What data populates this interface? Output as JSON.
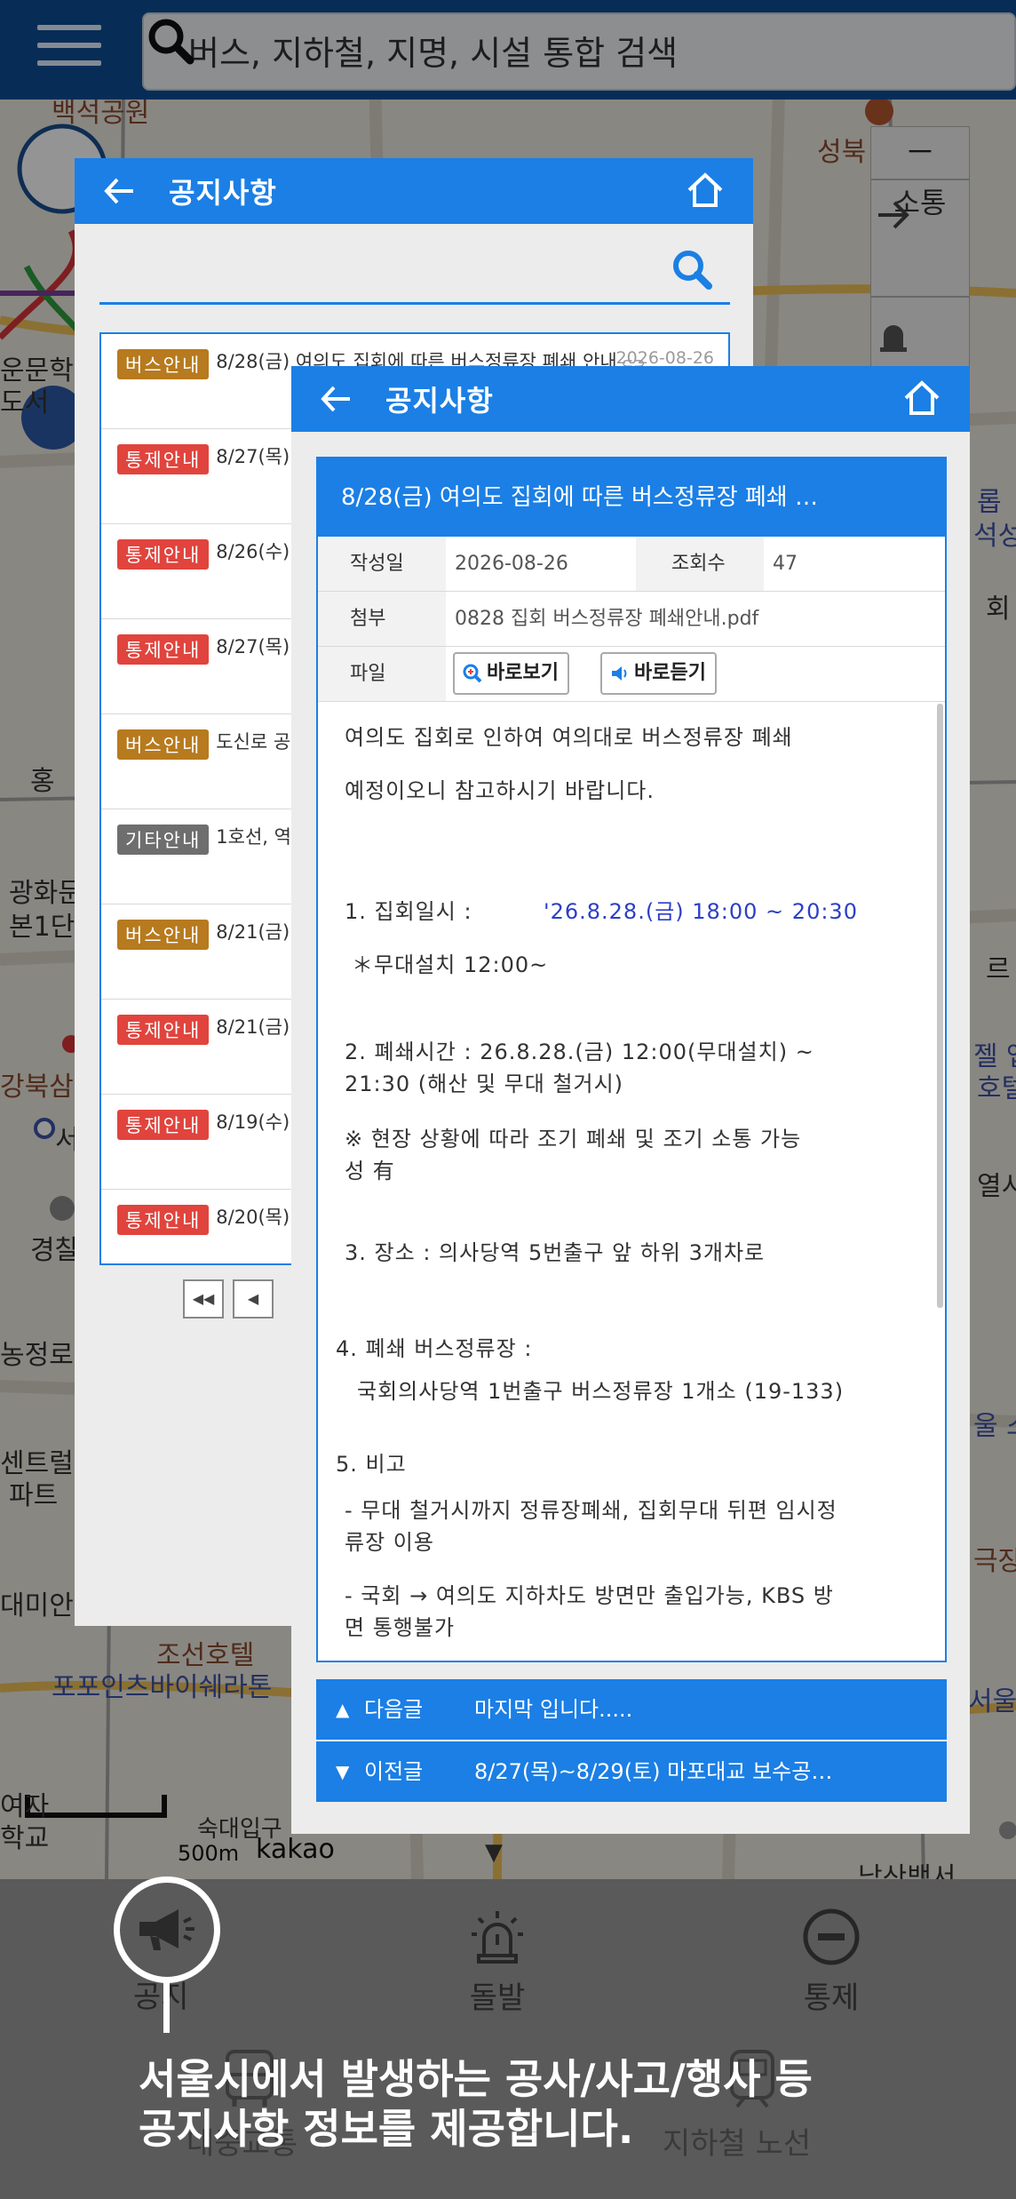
{
  "topbar": {
    "search_placeholder": "버스, 지하철, 지명, 시설 통합 검색"
  },
  "map": {
    "labels": [
      "백석공원",
      "성북",
      "운문학",
      "도서",
      "통제",
      "소통",
      "홍",
      "광화문",
      "본1단",
      "강북삼",
      "서",
      "경찰",
      "농정로역",
      "센트럴",
      "파트",
      "대미안",
      "조선호텔",
      "포포인츠바이쉐라톤",
      "숙대입구",
      "여자",
      "학교",
      "500m",
      "kakao",
      "남산백서",
      "롭",
      "석성",
      "회",
      "르",
      "젤 앱",
      "호텔",
      "열시",
      "울 스",
      "극장",
      "서울"
    ],
    "controls": {
      "minus": "－",
      "traffic_label": "소통"
    }
  },
  "list_panel": {
    "title": "공지사항",
    "items": [
      {
        "tag": "버스안내",
        "tag_color": "#b77a1e",
        "title": "8/28(금) 여의도 집회에 따른 버스정류장 폐쇄 안내",
        "date": "2026-08-26",
        "clip": true
      },
      {
        "tag": "통제안내",
        "tag_color": "#e0443d",
        "title": "8/27(목)~8/29(토) 마포대교 보수공사에 따른 교통통제 안내",
        "date": "",
        "clip": false
      },
      {
        "tag": "통제안내",
        "tag_color": "#e0443d",
        "title": "8/26(수)~ 도로 포장공사에 따른 교통통제 안내",
        "date": "",
        "clip": false
      },
      {
        "tag": "통제안내",
        "tag_color": "#e0443d",
        "title": "8/27(목) 도로 보수공사에 따른 교통통제 안내",
        "date": "",
        "clip": false
      },
      {
        "tag": "버스안내",
        "tag_color": "#b77a1e",
        "title": "도신로 공사에 따른 버스 임시우회 안내",
        "date": "",
        "clip": false
      },
      {
        "tag": "기타안내",
        "tag_color": "#6e6e6e",
        "title": "1호선, 역사 안전 안내",
        "date": "",
        "clip": false
      },
      {
        "tag": "버스안내",
        "tag_color": "#b77a1e",
        "title": "8/21(금) 시내버스 정류소 무정차 안내",
        "date": "",
        "clip": false
      },
      {
        "tag": "통제안내",
        "tag_color": "#e0443d",
        "title": "8/21(금) 행사에 따른 교통통제 안내",
        "date": "",
        "clip": false
      },
      {
        "tag": "통제안내",
        "tag_color": "#e0443d",
        "title": "8/19(수) 집회 단에 따른 교통통제 안내",
        "date": "",
        "clip": false
      },
      {
        "tag": "통제안내",
        "tag_color": "#e0443d",
        "title": "8/20(목) 교통통제 안내",
        "date": "",
        "clip": false
      }
    ],
    "pager": {
      "first": "◀◀",
      "prev": "◀"
    }
  },
  "detail_panel": {
    "title": "공지사항",
    "notice_title": "8/28(금) 여의도 집회에 따른 버스정류장 폐쇄 …",
    "meta": {
      "date_label": "작성일",
      "date": "2026-08-26",
      "views_label": "조회수",
      "views": "47",
      "attach_label": "첨부",
      "attach_file": "0828 집회 버스정류장 폐쇄안내.pdf",
      "file_label": "파일",
      "view_button": "바로보기",
      "listen_button": "바로듣기"
    },
    "body": [
      "여의도 집회로 인하여 여의대로 버스정류장 폐쇄",
      "예정이오니 참고하시기 바랍니다.",
      "1. 집회일시 :",
      "'26.8.28.(금) 18:00 ~ 20:30",
      "＊무대설치 12:00~",
      "2. 폐쇄시간 : 26.8.28.(금) 12:00(무대설치) ~",
      "21:30 (해산 및 무대 철거시)",
      "※ 현장 상황에 따라 조기 폐쇄 및 조기 소통 가능",
      "성 有",
      "3. 장소 : 의사당역 5번출구 앞 하위 3개차로",
      "4. 폐쇄 버스정류장 :",
      "국회의사당역 1번출구 버스정류장 1개소 (19-133)",
      "5. 비고",
      "- 무대 철거시까지 정류장폐쇄, 집회무대 뒤편 임시정",
      "류장 이용",
      "- 국회 → 여의도 지하차도 방면만 출입가능, KBS 방",
      "면 통행불가"
    ],
    "next": {
      "arrow": "▲",
      "label": "다음글",
      "text": "마지막 입니다....."
    },
    "prev": {
      "arrow": "▼",
      "label": "이전글",
      "text": "8/27(목)~8/29(토) 마포대교 보수공…"
    }
  },
  "bottom_nav": {
    "items": [
      "공지",
      "돌발",
      "통제"
    ],
    "hidden_items": [
      "대중교통",
      "지하철 노선"
    ]
  },
  "tooltip": {
    "line1": "서울시에서 발생하는 공사/사고/행사 등",
    "line2": "공지사항 정보를 제공합니다."
  }
}
